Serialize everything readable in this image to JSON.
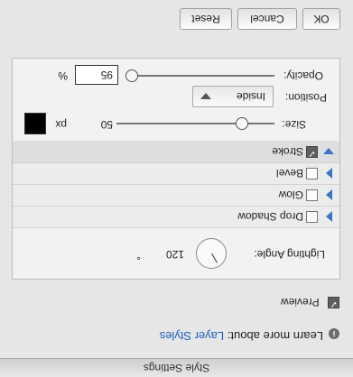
{
  "dialog": {
    "title": "Style Settings",
    "learn_more_prefix": "Learn more about:",
    "learn_more_link": "Layer Styles",
    "preview_label": "Preview"
  },
  "panel": {
    "lighting_angle_label": "Lighting Angle:",
    "lighting_angle_value": "120",
    "lighting_angle_unit": "°",
    "effects": [
      {
        "name": "Drop Shadow",
        "checked": false,
        "expanded": false
      },
      {
        "name": "Glow",
        "checked": false,
        "expanded": false
      },
      {
        "name": "Bevel",
        "checked": false,
        "expanded": false
      },
      {
        "name": "Stroke",
        "checked": true,
        "expanded": true
      }
    ],
    "stroke": {
      "size_label": "Size:",
      "size_value": "50",
      "size_unit": "px",
      "position_label": "Position:",
      "position_value": "Inside",
      "opacity_label": "Opacity:",
      "opacity_value": "95",
      "opacity_unit": "%",
      "color": "#000000",
      "size_fraction": 0.2,
      "opacity_fraction": 0.95
    }
  },
  "buttons": {
    "ok": "OK",
    "cancel": "Cancel",
    "reset": "Reset"
  },
  "colors": {
    "link": "#1f5fbf",
    "disclosure": "#3b74c5"
  }
}
